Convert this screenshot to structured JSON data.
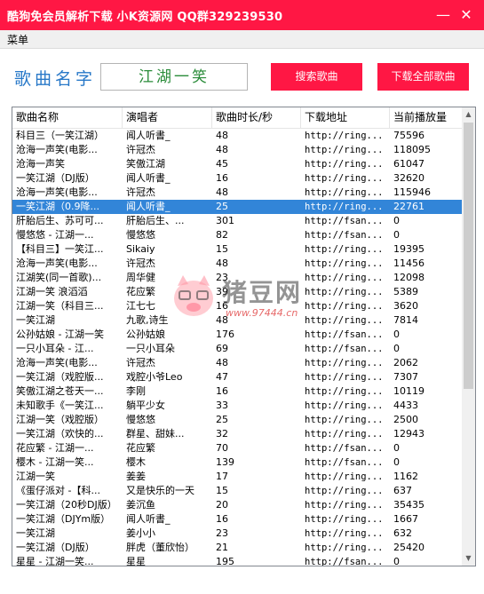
{
  "window": {
    "title": "酷狗免会员解析下载  小K资源网  QQ群329239530",
    "minimize_glyph": "—",
    "close_glyph": "✕"
  },
  "menu": {
    "label": "菜单"
  },
  "search": {
    "label": "歌曲名字",
    "value": "江湖一笑",
    "search_button": "搜索歌曲",
    "download_all_button": "下载全部歌曲"
  },
  "table": {
    "columns": [
      "歌曲名称",
      "演唱者",
      "歌曲时长/秒",
      "下载地址",
      "当前播放量"
    ],
    "selected_index": 5,
    "rows": [
      [
        "科目三（一笑江湖）",
        "闻人听書_",
        "48",
        "http://ring...",
        "75596"
      ],
      [
        "沧海一声笑(电影...",
        "许冠杰",
        "48",
        "http://ring...",
        "118095"
      ],
      [
        "沧海一声笑",
        "笑傲江湖",
        "45",
        "http://ring...",
        "61047"
      ],
      [
        "一笑江湖（DJ版）",
        "闻人听書_",
        "16",
        "http://ring...",
        "32620"
      ],
      [
        "沧海一声笑(电影...",
        "许冠杰",
        "48",
        "http://ring...",
        "115946"
      ],
      [
        "一笑江湖（0.9降...",
        "闻人听書_",
        "25",
        "http://ring...",
        "22761"
      ],
      [
        "肝胎后生、苏可可...",
        "肝胎后生、...",
        "301",
        "http://fsan...",
        "0"
      ],
      [
        "慢悠悠 - 江湖一...",
        "慢悠悠",
        "82",
        "http://fsan...",
        "0"
      ],
      [
        "【科目三】一笑江...",
        "Sikaiy",
        "15",
        "http://ring...",
        "19395"
      ],
      [
        "沧海一声笑(电影...",
        "许冠杰",
        "48",
        "http://ring...",
        "11456"
      ],
      [
        "江湖笑(同一首歌)...",
        "周华健",
        "23",
        "http://ring...",
        "12098"
      ],
      [
        "江湖一笑 浪滔滔",
        "花应繁",
        "39",
        "http://ring...",
        "5389"
      ],
      [
        "江湖一笑（科目三...",
        "江七七",
        "16",
        "http://ring...",
        "3620"
      ],
      [
        "一笑江湖",
        "九歌,诗生",
        "48",
        "http://ring...",
        "7814"
      ],
      [
        "公孙姑娘 - 江湖一笑",
        "公孙姑娘",
        "176",
        "http://fsan...",
        "0"
      ],
      [
        "一只小耳朵 - 江...",
        "一只小耳朵",
        "69",
        "http://fsan...",
        "0"
      ],
      [
        "沧海一声笑(电影...",
        "许冠杰",
        "48",
        "http://ring...",
        "2062"
      ],
      [
        "一笑江湖（戏腔版...",
        "戏腔小爷Leo",
        "47",
        "http://ring...",
        "7307"
      ],
      [
        "笑傲江湖之苍天一...",
        "李刚",
        "16",
        "http://ring...",
        "10119"
      ],
      [
        "未知歌手《一笑江...",
        "躺平少女",
        "33",
        "http://ring...",
        "4433"
      ],
      [
        "江湖一笑（戏腔版）",
        "慢悠悠",
        "25",
        "http://ring...",
        "2500"
      ],
      [
        "一笑江湖（欢快的...",
        "群星、甜妹...",
        "32",
        "http://ring...",
        "12943"
      ],
      [
        "花应繁 - 江湖一...",
        "花应繁",
        "70",
        "http://fsan...",
        "0"
      ],
      [
        "樱木 - 江湖一笑...",
        "樱木",
        "139",
        "http://fsan...",
        "0"
      ],
      [
        "江湖一笑",
        "姜姜",
        "17",
        "http://ring...",
        "1162"
      ],
      [
        "《蛋仔派对 -【科...",
        "又是快乐的一天",
        "15",
        "http://ring...",
        "637"
      ],
      [
        "一笑江湖（20秒DJ版）",
        "姜沉鱼",
        "20",
        "http://ring...",
        "35435"
      ],
      [
        "一笑江湖（DJYm版）",
        "闻人听書_",
        "16",
        "http://ring...",
        "1667"
      ],
      [
        "一笑江湖",
        "姜小小",
        "23",
        "http://ring...",
        "632"
      ],
      [
        "一笑江湖（DJ版）",
        "胖虎（董欣怡）",
        "21",
        "http://ring...",
        "25420"
      ],
      [
        "星星 - 江湖一笑...",
        "星星",
        "195",
        "http://fsan...",
        "0"
      ]
    ]
  },
  "watermark": {
    "text": "猪豆网",
    "url": "www.97444.cn"
  },
  "colors": {
    "brand": "#ff1744",
    "accent_label": "#2878c8",
    "input_text": "#2a8c3a",
    "selection": "#3285d8"
  }
}
